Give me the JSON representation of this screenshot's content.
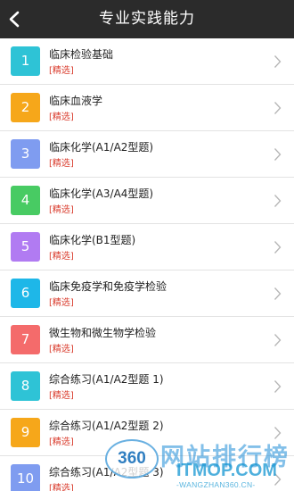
{
  "header": {
    "title": "专业实践能力",
    "back_icon": "chevron-left-icon"
  },
  "rows": [
    {
      "number": "1",
      "title": "临床检验基础",
      "tag": "[精选]",
      "color": "#2ec3d6"
    },
    {
      "number": "2",
      "title": "临床血液学",
      "tag": "[精选]",
      "color": "#f6a71a"
    },
    {
      "number": "3",
      "title": "临床化学(A1/A2型题)",
      "tag": "[精选]",
      "color": "#7f9cf0"
    },
    {
      "number": "4",
      "title": "临床化学(A3/A4型题)",
      "tag": "[精选]",
      "color": "#48cb63"
    },
    {
      "number": "5",
      "title": "临床化学(B1型题)",
      "tag": "[精选]",
      "color": "#b17bf2"
    },
    {
      "number": "6",
      "title": "临床免疫学和免疫学检验",
      "tag": "[精选]",
      "color": "#1eb7e8"
    },
    {
      "number": "7",
      "title": "微生物和微生物学检验",
      "tag": "[精选]",
      "color": "#f46b6b"
    },
    {
      "number": "8",
      "title": "综合练习(A1/A2型题 1)",
      "tag": "[精选]",
      "color": "#2ec3d6"
    },
    {
      "number": "9",
      "title": "综合练习(A1/A2型题 2)",
      "tag": "[精选]",
      "color": "#f6a71a"
    },
    {
      "number": "10",
      "title": "综合练习(A1/A2型题 3)",
      "tag": "[精选]",
      "color": "#7f9cf0"
    }
  ],
  "row_chevron_icon": "chevron-right-icon",
  "watermark": {
    "logo_text": "360",
    "title": "网站排行榜",
    "domain": "ITMOP.COM",
    "sub": "-WANGZHAN360.CN-"
  },
  "colors": {
    "header_bg": "#2b2b2b",
    "tag_red": "#d93a2b"
  }
}
